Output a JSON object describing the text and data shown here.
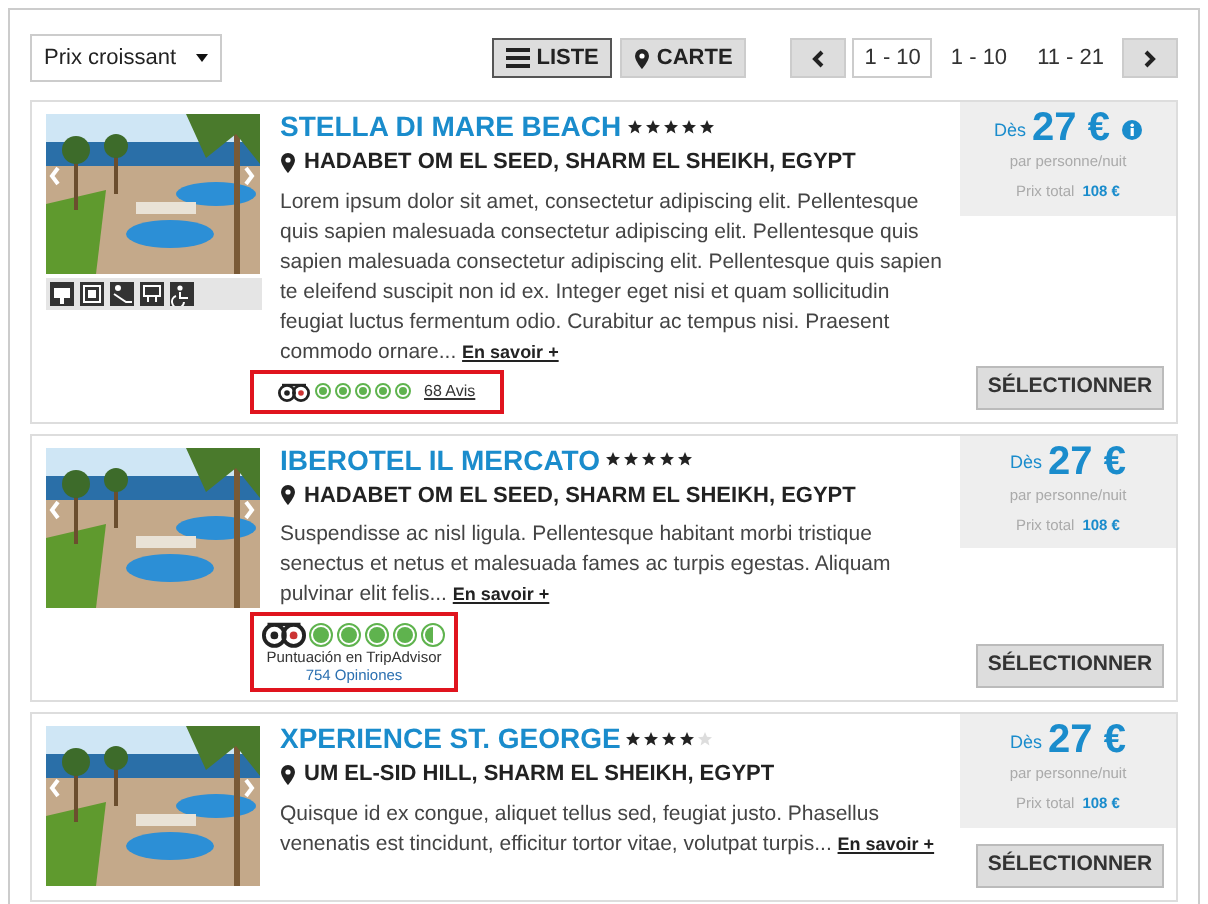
{
  "sort": {
    "value": "Prix croissant"
  },
  "views": [
    {
      "label": "LISTE",
      "selected": true
    },
    {
      "label": "CARTE",
      "selected": false
    }
  ],
  "pagination": {
    "pages": [
      {
        "label": "1 - 10",
        "selected": true
      },
      {
        "label": "1 - 10",
        "selected": false
      },
      {
        "label": "11 - 21",
        "selected": false
      }
    ]
  },
  "hotels": [
    {
      "name": "STELLA DI MARE BEACH",
      "stars": 5,
      "location": "HADABET OM EL SEED, SHARM EL SHEIKH, EGYPT",
      "description": "Lorem ipsum dolor sit amet, consectetur adipiscing elit. Pellentesque quis sapien malesuada consectetur adipiscing elit. Pellentesque quis sapien malesuada consectetur adipiscing elit. Pellentesque quis sapien te eleifend suscipit non id ex. Integer eget nisi et quam sollicitudin feugiat luctus fermentum odio. Curabitur ac tempus nisi. Praesent commodo ornare...",
      "more": "En savoir +",
      "amenities": true,
      "review": {
        "kind": "compact",
        "stars": 5,
        "count": "68 Avis",
        "highlighted": true
      },
      "price": {
        "from": "Dès",
        "amount": "27 €",
        "info": true,
        "per": "par personne/nuit",
        "total_label": "Prix total",
        "total": "108 €"
      },
      "button": "SÉLECTIONNER"
    },
    {
      "name": "IBEROTEL IL MERCATO",
      "stars": 5,
      "location": "HADABET OM EL SEED, SHARM EL SHEIKH, EGYPT",
      "description": "Suspendisse ac nisl ligula. Pellentesque habitant morbi tristique senectus et netus et malesuada fames ac turpis egestas. Aliquam pulvinar elit felis...",
      "more": "En savoir +",
      "amenities": false,
      "review": {
        "kind": "detailed",
        "stars": 4.5,
        "caption": "Puntuación en TripAdvisor",
        "count": "754 Opiniones",
        "highlighted": true
      },
      "price": {
        "from": "Dès",
        "amount": "27 €",
        "info": false,
        "per": "par personne/nuit",
        "total_label": "Prix total",
        "total": "108 €"
      },
      "button": "SÉLECTIONNER"
    },
    {
      "name": "XPERIENCE ST. GEORGE",
      "stars": 4,
      "location": "UM EL-SID HILL, SHARM EL SHEIKH, EGYPT",
      "description": "Quisque id ex congue, aliquet tellus sed, feugiat justo. Phasellus venenatis est tincidunt, efficitur tortor vitae, volutpat turpis...",
      "more": "En savoir +",
      "amenities": false,
      "price": {
        "from": "Dès",
        "amount": "27 €",
        "info": false,
        "per": "par personne/nuit",
        "total_label": "Prix total",
        "total": "108 €"
      },
      "button": "SÉLECTIONNER"
    }
  ]
}
